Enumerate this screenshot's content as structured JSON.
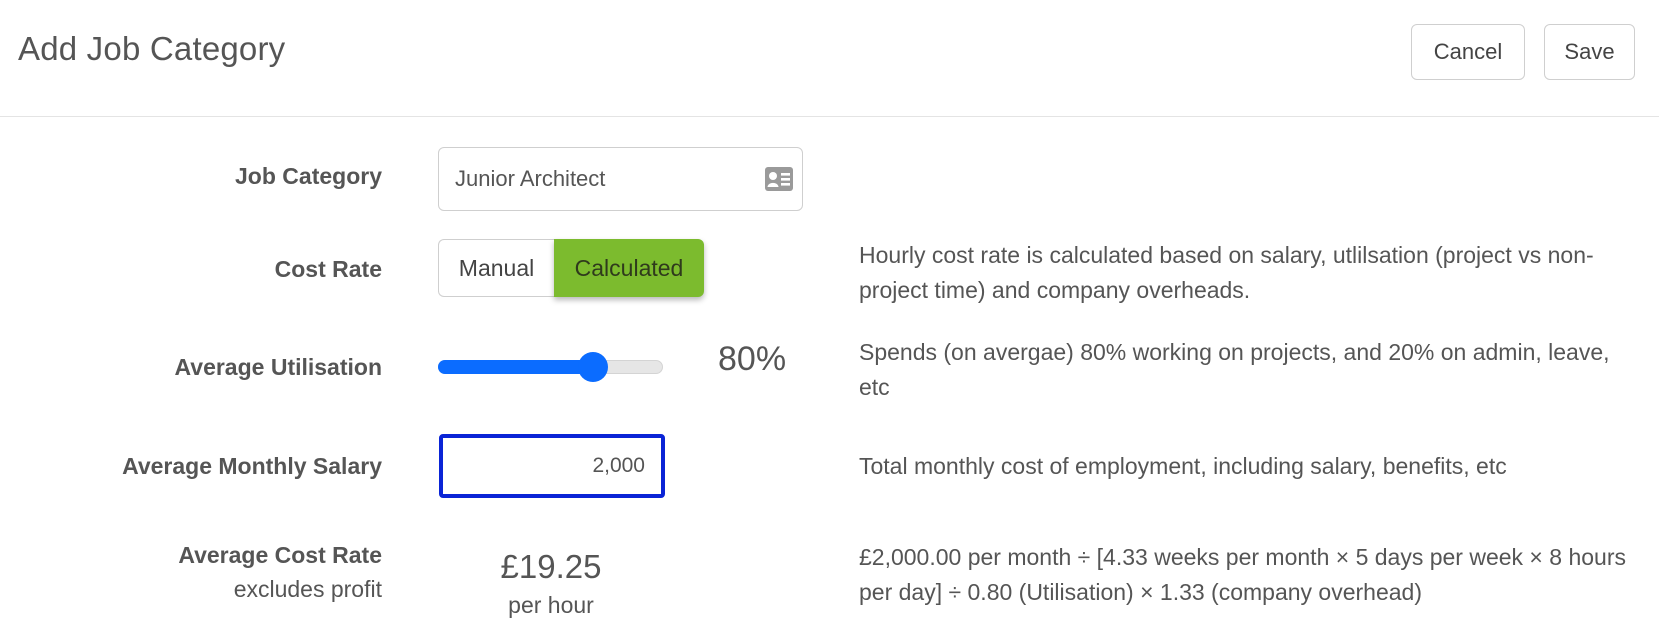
{
  "header": {
    "title": "Add Job Category",
    "cancel_label": "Cancel",
    "save_label": "Save"
  },
  "form": {
    "job_category": {
      "label": "Job Category",
      "value": "Junior Architect",
      "icon": "contact-card-icon"
    },
    "cost_rate": {
      "label": "Cost Rate",
      "options": [
        "Manual",
        "Calculated"
      ],
      "selected": "Calculated",
      "selected_color": "#7cbb2e",
      "description": "Hourly cost rate is calculated based on salary, utlilsation (project vs non-project time) and company overheads."
    },
    "utilisation": {
      "label": "Average Utilisation",
      "value_text": "80%",
      "value_fraction": 0.8,
      "slider_color": "#0b6cff",
      "description": "Spends (on avergae) 80% working on projects, and 20% on admin, leave, etc"
    },
    "salary": {
      "label": "Average Monthly Salary",
      "value": "2,000",
      "focus_color": "#0a24d6",
      "description": "Total monthly cost of employment, including salary, benefits, etc"
    },
    "cost_rate_result": {
      "label": "Average Cost Rate",
      "sublabel": "excludes profit",
      "amount": "£19.25",
      "unit": "per hour",
      "description": "£2,000.00 per month ÷ [4.33 weeks per month × 5 days per week × 8 hours per day] ÷ 0.80 (Utilisation) × 1.33 (company overhead)"
    }
  }
}
